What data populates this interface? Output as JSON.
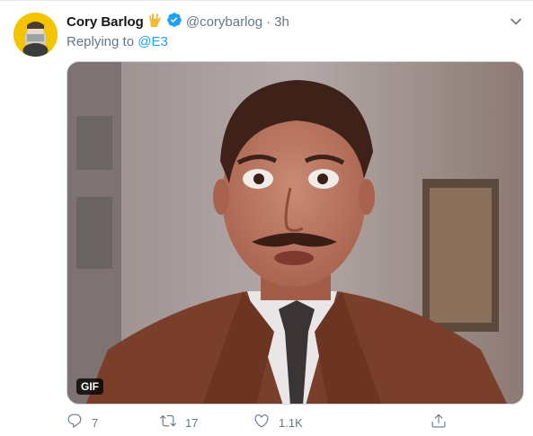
{
  "tweet": {
    "display_name": "Cory Barlog",
    "handle": "@corybarlog",
    "separator": "·",
    "time": "3h",
    "replying_prefix": "Replying to",
    "replying_to": "@E3",
    "media_badge": "GIF",
    "actions": {
      "reply_count": "7",
      "retweet_count": "17",
      "like_count": "1.1K"
    }
  },
  "colors": {
    "accent": "#1da1f2",
    "muted_text": "#657786",
    "name_text": "#14171a",
    "hand_emoji": "#f5b93a",
    "avatar_bg": "#f5c400"
  },
  "icons": [
    "vulcan-salute-icon",
    "verified-badge-icon",
    "chevron-down-icon",
    "reply-icon",
    "retweet-icon",
    "like-icon",
    "share-icon"
  ]
}
